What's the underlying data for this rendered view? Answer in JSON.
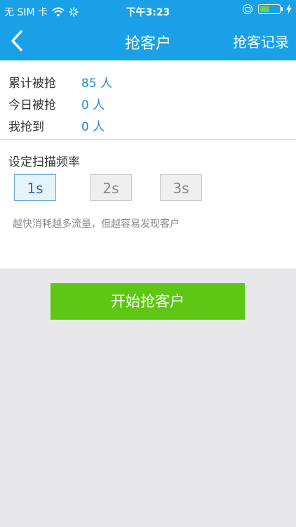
{
  "status_bar": {
    "carrier": "无 SIM 卡",
    "time": "下午3:23",
    "battery_level": 0.52
  },
  "nav": {
    "back_icon": "chevron-left-icon",
    "title": "抢客户",
    "record_label": "抢客记录"
  },
  "stats": [
    {
      "label": "累计被抢",
      "value": "85 人"
    },
    {
      "label": "今日被抢",
      "value": "0 人"
    },
    {
      "label": "我抢到",
      "value": "0 人"
    }
  ],
  "frequency": {
    "title": "设定扫描频率",
    "options": [
      "1s",
      "2s",
      "3s"
    ],
    "selected": "1s",
    "hint": "越快消耗越多流量，但越容易发现客户"
  },
  "start_button": {
    "label": "开始抢客户"
  },
  "colors": {
    "header": "#1aa0e6",
    "accent_text": "#1d8bd0",
    "start_button": "#5ec614"
  }
}
